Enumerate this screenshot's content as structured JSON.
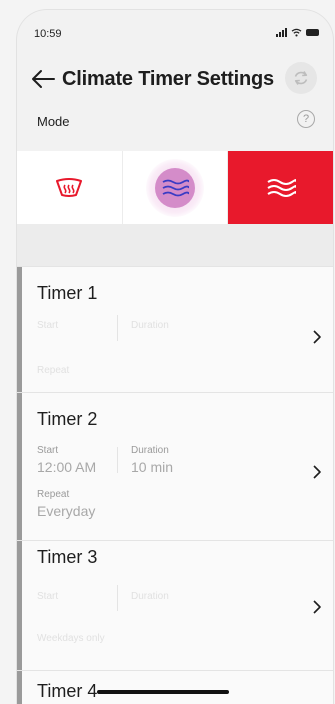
{
  "status_bar": {
    "time": "10:59",
    "icons": [
      "signal-icon",
      "wifi-icon",
      "battery-icon"
    ]
  },
  "header": {
    "back_icon": "arrow-left-icon",
    "title": "Climate Timer Settings",
    "refresh_icon": "refresh-icon"
  },
  "mode": {
    "label": "Mode",
    "help_icon": "?",
    "options": [
      {
        "icon": "defrost-icon",
        "state": "inactive"
      },
      {
        "icon": "airflow-icon",
        "state": "pressed"
      },
      {
        "icon": "heat-waves-icon",
        "state": "selected"
      }
    ],
    "accent_color": "#e8192c",
    "pressed_color": "#d48cc9"
  },
  "timers": [
    {
      "title": "Timer 1",
      "start_label": "Start",
      "duration_label": "Duration",
      "repeat_label": "Repeat"
    },
    {
      "title": "Timer 2",
      "start_label": "Start",
      "start_value": "12:00 AM",
      "duration_label": "Duration",
      "duration_value": "10 min",
      "repeat_label": "Repeat",
      "repeat_value": "Everyday"
    },
    {
      "title": "Timer 3",
      "start_label": "Start",
      "duration_label": "Duration",
      "repeat_label": "Weekdays only"
    },
    {
      "title": "Timer 4"
    }
  ]
}
